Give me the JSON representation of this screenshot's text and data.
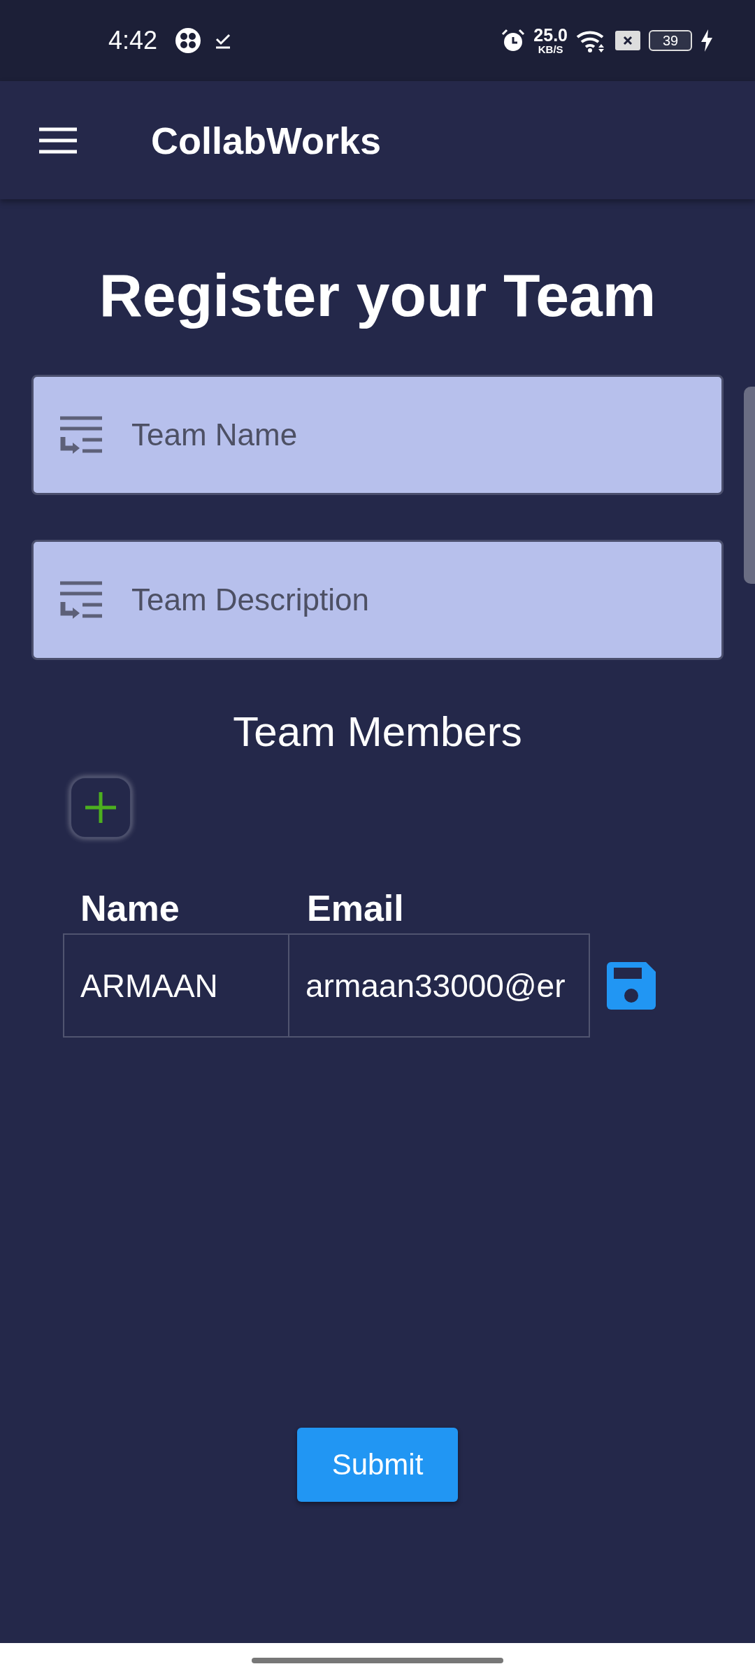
{
  "status_bar": {
    "time": "4:42",
    "speed": "25.0",
    "speed_unit": "KB/S",
    "battery": "39"
  },
  "app_bar": {
    "title": "CollabWorks"
  },
  "heading": "Register your Team",
  "fields": [
    {
      "placeholder": "Team Name"
    },
    {
      "placeholder": "Team Description"
    }
  ],
  "members": {
    "title": "Team Members",
    "columns": [
      "Name",
      "Email"
    ],
    "rows": [
      [
        "ARMAAN",
        "armaan33000@er"
      ]
    ]
  },
  "submit": "Submit"
}
